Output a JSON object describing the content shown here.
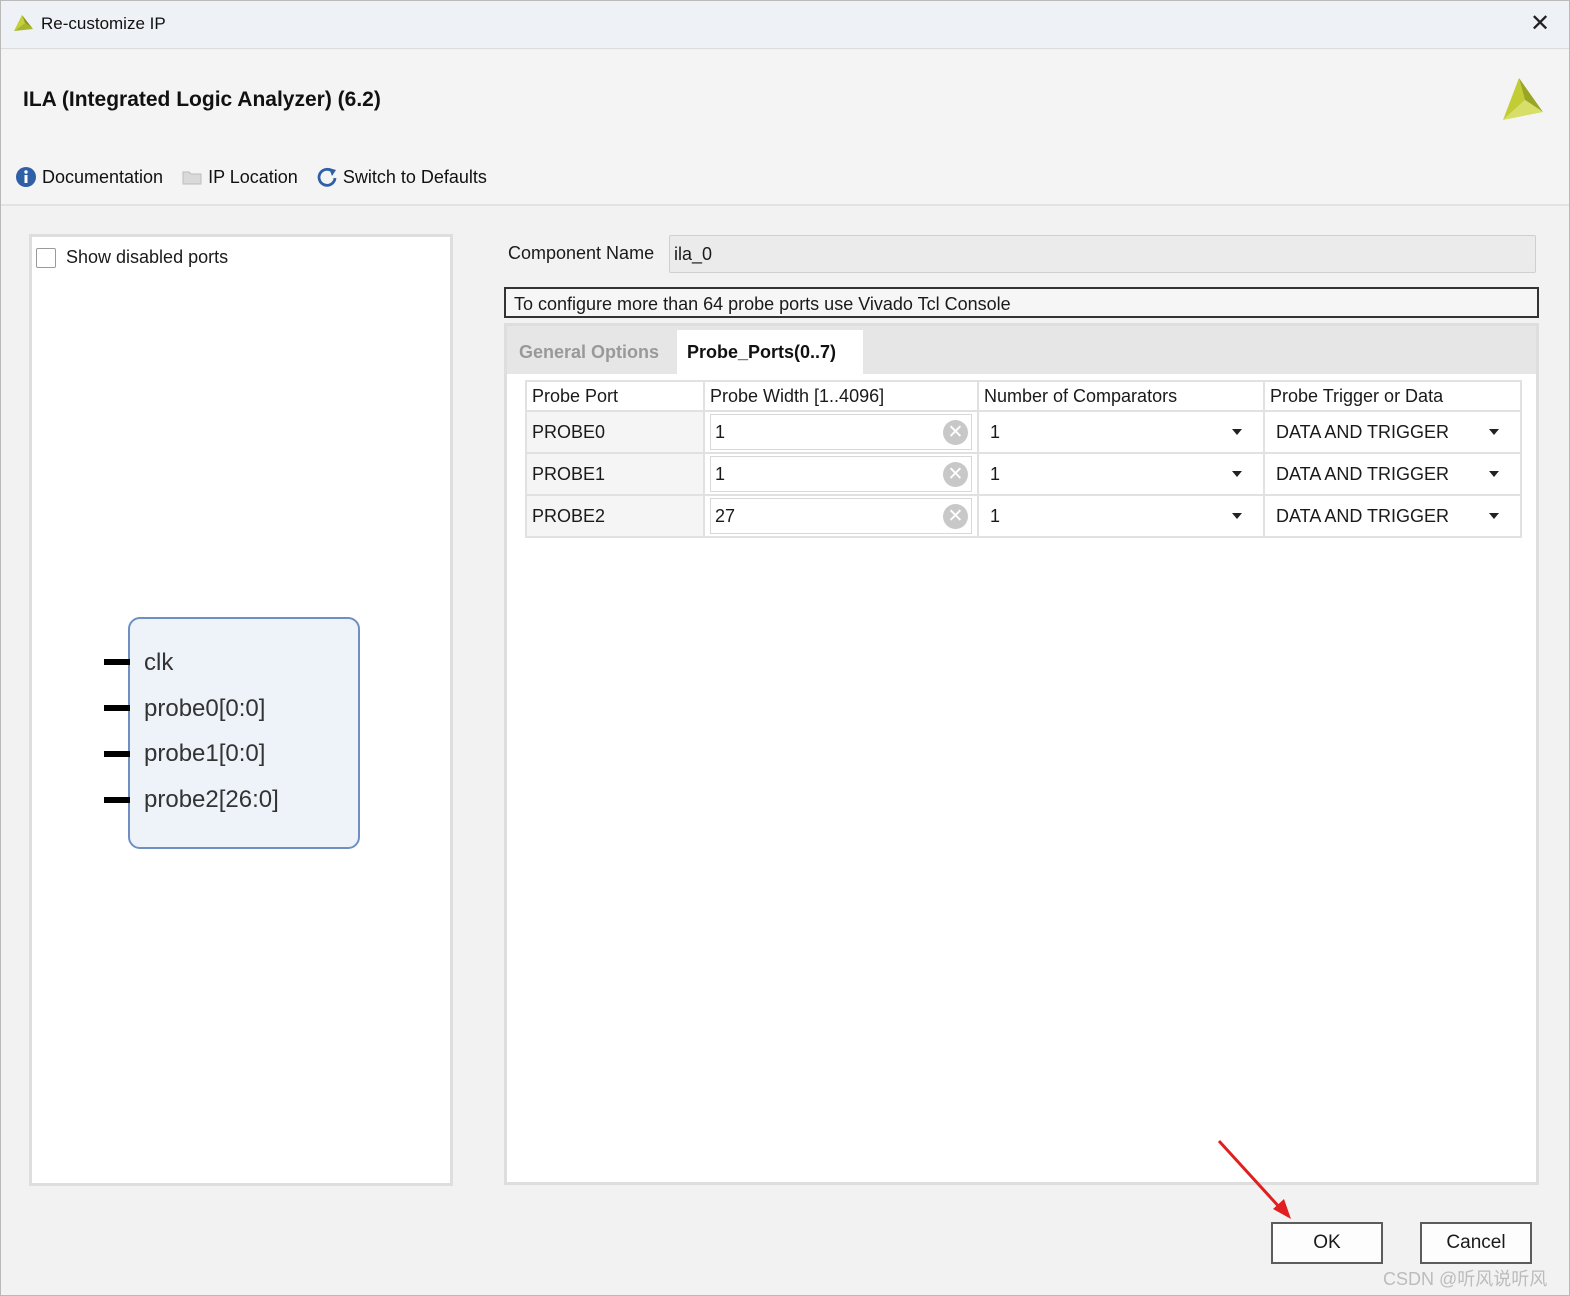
{
  "window": {
    "title": "Re-customize IP",
    "close_glyph": "✕"
  },
  "header": {
    "ip_title": "ILA (Integrated Logic Analyzer) (6.2)",
    "toolbar": [
      {
        "label": "Documentation",
        "icon": "info-icon"
      },
      {
        "label": "IP Location",
        "icon": "folder-icon"
      },
      {
        "label": "Switch to Defaults",
        "icon": "refresh-icon"
      }
    ]
  },
  "left_panel": {
    "show_disabled_ports": {
      "label": "Show disabled ports",
      "checked": false
    },
    "symbol_pins": [
      "clk",
      "probe0[0:0]",
      "probe1[0:0]",
      "probe2[26:0]"
    ]
  },
  "component": {
    "label": "Component Name",
    "value": "ila_0"
  },
  "notice": "To configure more than 64 probe ports use Vivado Tcl Console",
  "tabs": [
    {
      "label": "General Options",
      "active": false
    },
    {
      "label": "Probe_Ports(0..7)",
      "active": true
    }
  ],
  "table": {
    "headers": [
      "Probe Port",
      "Probe Width [1..4096]",
      "Number of Comparators",
      "Probe Trigger or Data"
    ],
    "rows": [
      {
        "port": "PROBE0",
        "width": "1",
        "comparators": "1",
        "trigger": "DATA AND TRIGGER"
      },
      {
        "port": "PROBE1",
        "width": "1",
        "comparators": "1",
        "trigger": "DATA AND TRIGGER"
      },
      {
        "port": "PROBE2",
        "width": "27",
        "comparators": "1",
        "trigger": "DATA AND TRIGGER"
      }
    ]
  },
  "buttons": {
    "ok": "OK",
    "cancel": "Cancel"
  },
  "watermark": "CSDN @听风说听风",
  "colors": {
    "accent": "#6f8fc3",
    "annotation_arrow": "#e02020",
    "xilinx_logo": "#b8c42a"
  }
}
